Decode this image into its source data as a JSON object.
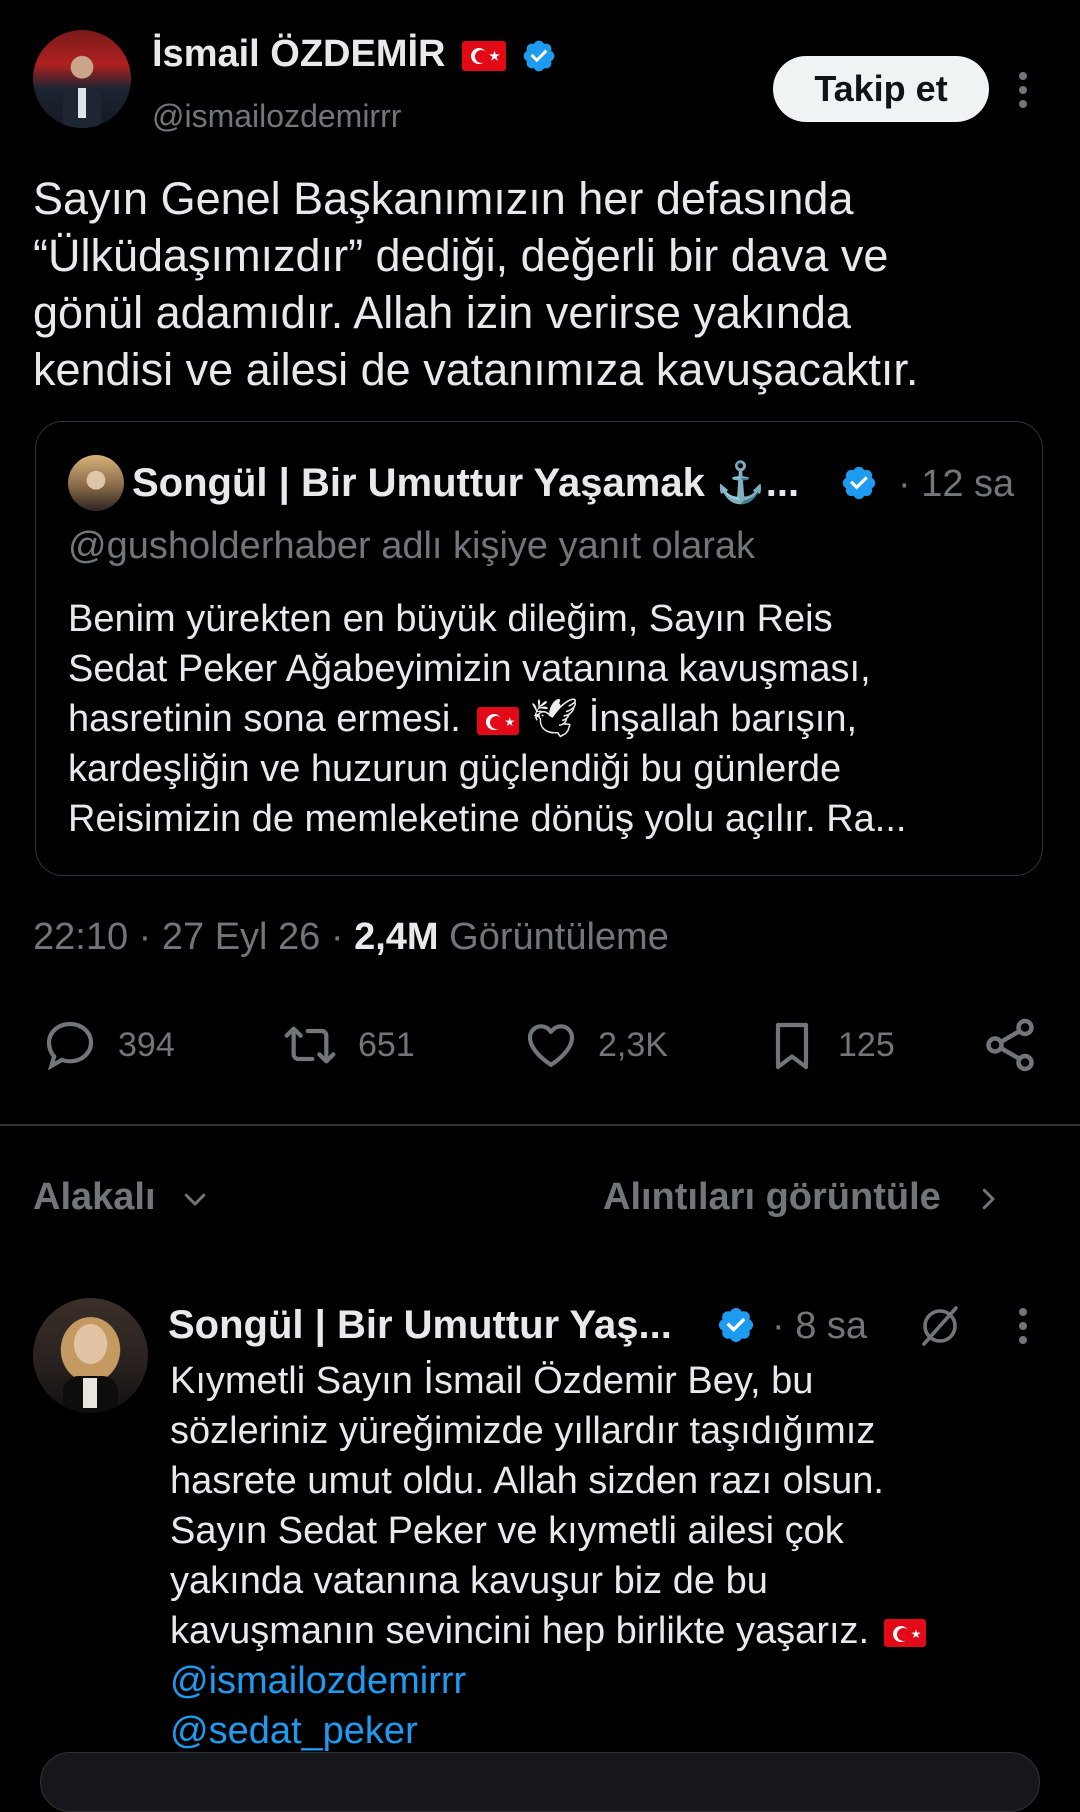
{
  "colors": {
    "background": "#000000",
    "text": "#e7e9ea",
    "muted": "#71767b",
    "accent": "#1d9bf0",
    "verified": "#1d9bf0",
    "follow_button_bg": "#eff3f4"
  },
  "author": {
    "name": "İsmail ÖZDEMİR",
    "handle": "@ismailozdemirrr",
    "verified": true,
    "flag_icon": "turkey-flag-icon"
  },
  "follow_button": {
    "label": "Takip et"
  },
  "tweet": {
    "lines": [
      "Sayın Genel Başkanımızın her defasında",
      "“Ülküdaşımızdır” dediği, değerli bir dava ve",
      "gönül adamıdır. Allah izin verirse yakında",
      "kendisi ve ailesi de vatanımıza kavuşacaktır."
    ]
  },
  "quoted": {
    "name": "Songül | Bir Umuttur Yaşamak ⚓...",
    "verified": true,
    "time": "· 12 sa",
    "reply_context": "@gusholderhaber adlı kişiye yanıt olarak",
    "lines": [
      "Benim yürekten en büyük dileğim, Sayın Reis",
      "Sedat Peker Ağabeyimizin vatanına kavuşması,",
      "hasretinin sona ermesi.",
      "İnşallah barışın,",
      "kardeşliğin ve huzurun güçlendiği bu günlerde",
      "Reisimizin de memleketine dönüş yolu açılır. Ra..."
    ],
    "emoji_dove": "🕊"
  },
  "meta": {
    "time": "22:10",
    "date": "27 Eyl 26",
    "separator": "·",
    "views_count": "2,4M",
    "views_label": "Görüntüleme"
  },
  "actions": {
    "reply": {
      "icon": "reply-icon",
      "count": "394"
    },
    "retweet": {
      "icon": "retweet-icon",
      "count": "651"
    },
    "like": {
      "icon": "heart-icon",
      "count": "2,3K"
    },
    "bookmark": {
      "icon": "bookmark-icon",
      "count": "125"
    },
    "share": {
      "icon": "share-icon"
    }
  },
  "filter_bar": {
    "sort_label": "Alakalı",
    "quotes_label": "Alıntıları görüntüle"
  },
  "reply": {
    "name": "Songül | Bir Umuttur Yaş...",
    "verified": true,
    "time": "· 8 sa",
    "lines": [
      "Kıymetli Sayın İsmail Özdemir Bey, bu",
      "sözleriniz yüreğimizde yıllardır taşıdığımız",
      "hasrete umut oldu. Allah sizden razı olsun.",
      "Sayın Sedat Peker ve kıymetli ailesi çok",
      "yakında vatanına kavuşur biz de bu",
      "kavuşmanın sevincini hep birlikte yaşarız."
    ],
    "mentions": [
      "@ismailozdemirrr",
      "@sedat_peker"
    ]
  }
}
